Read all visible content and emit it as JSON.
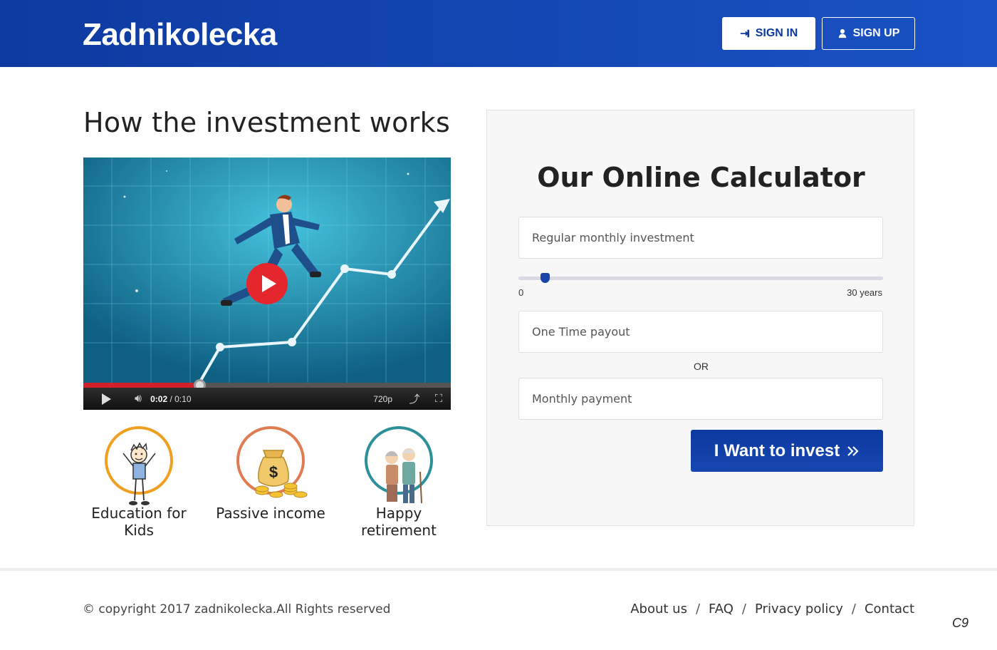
{
  "header": {
    "logo": "Zadnikolecka",
    "signin_label": "SIGN IN",
    "signup_label": "SIGN UP",
    "signin_icon": "sign-in-icon",
    "signup_icon": "user-icon"
  },
  "main": {
    "title": "How the investment works",
    "video": {
      "time_current": "0:02",
      "time_total": "/ 0:10",
      "quality": "720p",
      "progress": 0.2
    },
    "features": [
      {
        "label": "Education for Kids",
        "icon": "kid-icon",
        "color": "#f0a020"
      },
      {
        "label": "Passive income",
        "icon": "money-bag-icon",
        "color": "#e07b52"
      },
      {
        "label": "Happy retirement",
        "icon": "elderly-couple-icon",
        "color": "#2d8f9a"
      }
    ]
  },
  "calculator": {
    "title": "Our Online Calculator",
    "monthly_placeholder": "Regular monthly investment",
    "slider_min": "0",
    "slider_max": "30 years",
    "payout_placeholder": "One Time payout",
    "or_label": "OR",
    "monthly_payment_placeholder": "Monthly payment",
    "invest_label": "I Want to invest",
    "invest_icon": "double-chevron-right-icon"
  },
  "footer": {
    "copyright": "© copyright 2017 zadnikolecka.All Rights reserved",
    "links": [
      "About us",
      "FAQ",
      "Privacy policy",
      "Contact"
    ],
    "separator": "/",
    "corner": "C9"
  },
  "colors": {
    "brand": "#0d3aa0",
    "play_red": "#e5272d"
  }
}
